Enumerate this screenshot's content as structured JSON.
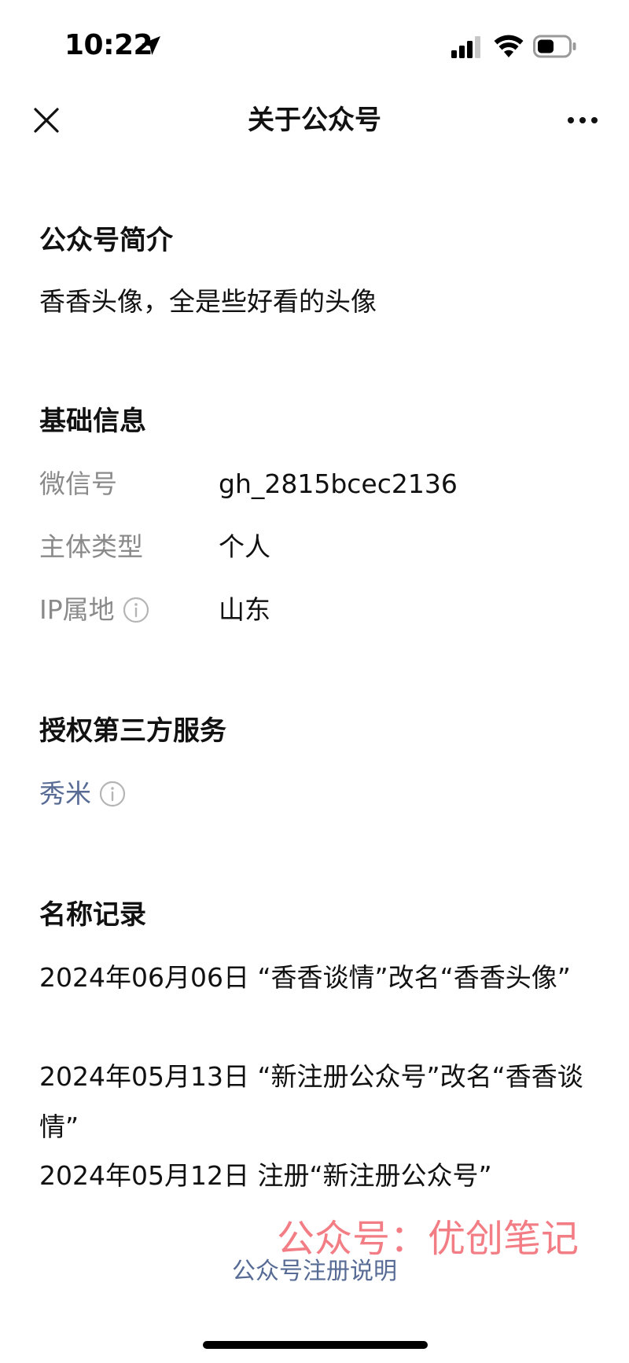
{
  "status_bar": {
    "time": "10:22"
  },
  "nav": {
    "title": "关于公众号"
  },
  "intro": {
    "heading": "公众号简介",
    "text": "香香头像，全是些好看的头像"
  },
  "basic_info": {
    "heading": "基础信息",
    "rows": [
      {
        "label": "微信号",
        "value": "gh_2815bcec2136"
      },
      {
        "label": "主体类型",
        "value": "个人"
      },
      {
        "label": "IP属地",
        "value": "山东"
      }
    ]
  },
  "services": {
    "heading": "授权第三方服务",
    "items": [
      {
        "label": "秀米"
      }
    ]
  },
  "name_history": {
    "heading": "名称记录",
    "items": [
      "2024年06月06日 “香香谈情”改名“香香头像”",
      "2024年05月13日 “新注册公众号”改名“香香谈情”",
      "2024年05月12日 注册“新注册公众号”"
    ]
  },
  "watermark": "公众号：优创笔记",
  "footer": {
    "link": "公众号注册说明"
  },
  "colors": {
    "link": "#576b95",
    "label_gray": "#8a8a8a",
    "watermark": "#f2737a"
  }
}
